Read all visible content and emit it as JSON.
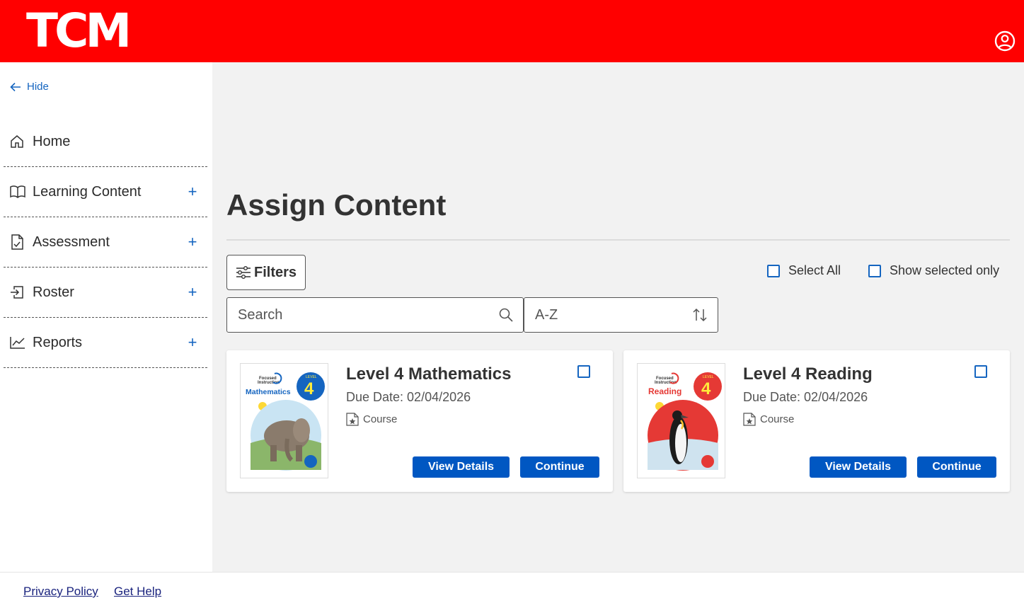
{
  "header": {
    "logo_text": "TCM",
    "account_icon": "user-circle-icon"
  },
  "sidebar": {
    "hide_label": "Hide",
    "items": [
      {
        "label": "Home",
        "icon": "home-icon",
        "expandable": false
      },
      {
        "label": "Learning Content",
        "icon": "book-icon",
        "expandable": true
      },
      {
        "label": "Assessment",
        "icon": "assessment-icon",
        "expandable": true
      },
      {
        "label": "Roster",
        "icon": "roster-icon",
        "expandable": true
      },
      {
        "label": "Reports",
        "icon": "reports-chart-icon",
        "expandable": true
      }
    ]
  },
  "main": {
    "title": "Assign Content",
    "filters_label": "Filters",
    "select_all_label": "Select All",
    "show_selected_label": "Show selected only",
    "search_placeholder": "Search",
    "sort_value": "A-Z"
  },
  "cards": [
    {
      "title": "Level 4 Mathematics",
      "due_date": "Due Date: 02/04/2026",
      "type": "Course",
      "view_details_label": "View Details",
      "continue_label": "Continue",
      "cover": {
        "series_top": "Focused",
        "series_mid": "Instruction",
        "subject": "Mathematics",
        "level_word": "LEVEL",
        "level": "4",
        "accent": "#1565c0",
        "image": "elephant"
      }
    },
    {
      "title": "Level 4 Reading",
      "due_date": "Due Date: 02/04/2026",
      "type": "Course",
      "view_details_label": "View Details",
      "continue_label": "Continue",
      "cover": {
        "series_top": "Focused",
        "series_mid": "Instruction",
        "subject": "Reading",
        "level_word": "LEVEL",
        "level": "4",
        "accent": "#e53935",
        "image": "penguin"
      }
    }
  ],
  "footer": {
    "privacy_label": "Privacy Policy",
    "help_label": "Get Help"
  },
  "colors": {
    "brand_red": "#ff0000",
    "primary_blue": "#0057c2",
    "link_blue": "#1565c0"
  }
}
